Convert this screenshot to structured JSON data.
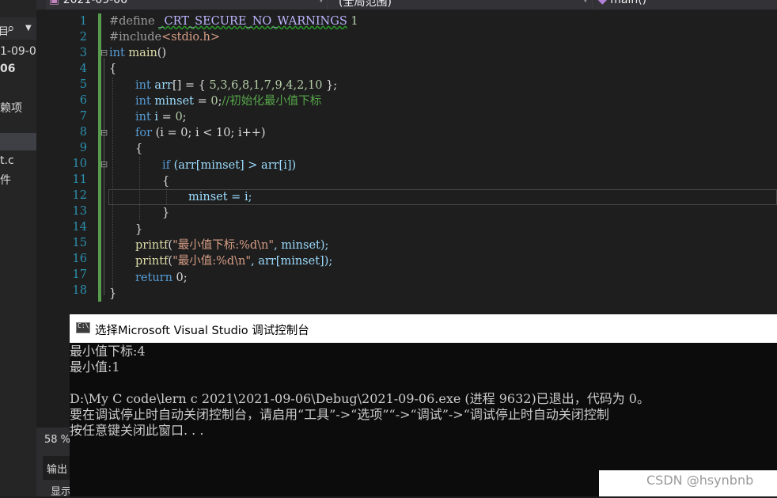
{
  "navbar": {
    "scope_value": "2021-09-06",
    "context_value": "(全局范围)",
    "member_value": "main()"
  },
  "left_panel": {
    "fragments": [
      "1-09-0",
      "06",
      "赖项",
      "t.c",
      "件"
    ]
  },
  "editor": {
    "line_numbers": [
      "1",
      "2",
      "3",
      "4",
      "5",
      "6",
      "7",
      "8",
      "9",
      "10",
      "11",
      "12",
      "13",
      "14",
      "15",
      "16",
      "17",
      "18"
    ],
    "code": {
      "l1_directive": "#define ",
      "l1_macro": "_CRT_SECURE_NO_WARNINGS",
      "l1_value": " 1",
      "l2_directive": "#include",
      "l2_header": "<stdio.h>",
      "l3_type": "int",
      "l3_name": " main",
      "l3_paren": "()",
      "l4": "{",
      "l5_type": "int",
      "l5_var": " arr",
      "l5_rest": "[] = { ",
      "l5_nums": "5,3,6,8,1,7,9,4,2,10",
      "l5_end": " };",
      "l6_type": "int",
      "l6_var": " minset",
      "l6_eq": " = ",
      "l6_num": "0",
      "l6_semi": ";",
      "l6_comment": "//初始化最小值下标",
      "l7_type": "int",
      "l7_var": " i",
      "l7_eq": " = ",
      "l7_num": "0",
      "l7_semi": ";",
      "l8_kw": "for",
      "l8_rest": " (i = 0; i < 10; i++)",
      "l9": "{",
      "l10_kw": "if",
      "l10_rest": " (arr[minset] > arr[i])",
      "l11": "{",
      "l12": "minset = i;",
      "l13": "}",
      "l14": "}",
      "l15_fn": "printf",
      "l15_open": "(",
      "l15_str": "\"最小值下标:%d\\n\"",
      "l15_rest": ", minset);",
      "l16_fn": "printf",
      "l16_open": "(",
      "l16_str": "\"最小值:%d\\n\"",
      "l16_rest": ", arr[minset]);",
      "l17_kw": "return",
      "l17_rest": " 0;",
      "l18": "}"
    },
    "zoom": "58 %"
  },
  "bottom_panel": {
    "output_tab": "输出",
    "show_label": "显示"
  },
  "console": {
    "title": "选择Microsoft Visual Studio 调试控制台",
    "icon_text": "C:\\",
    "lines": [
      "最小值下标:4",
      "最小值:1",
      "",
      "D:\\My C code\\lern c 2021\\2021-09-06\\Debug\\2021-09-06.exe (进程 9632)已退出，代码为 0。",
      "要在调试停止时自动关闭控制台，请启用“工具”->“选项”“->“调试”->“调试停止时自动关闭控制",
      "按任意键关闭此窗口. . ."
    ]
  },
  "watermark": "CSDN @hsynbnb",
  "colors": {
    "editor_bg": "#1e1e1e",
    "keyword": "#569cd6",
    "comment": "#57a64a",
    "string": "#d69d85",
    "variable": "#9cdcfe",
    "function": "#dcdcaa",
    "line_number": "#2b91af",
    "console_bg": "#0c0c0c"
  }
}
